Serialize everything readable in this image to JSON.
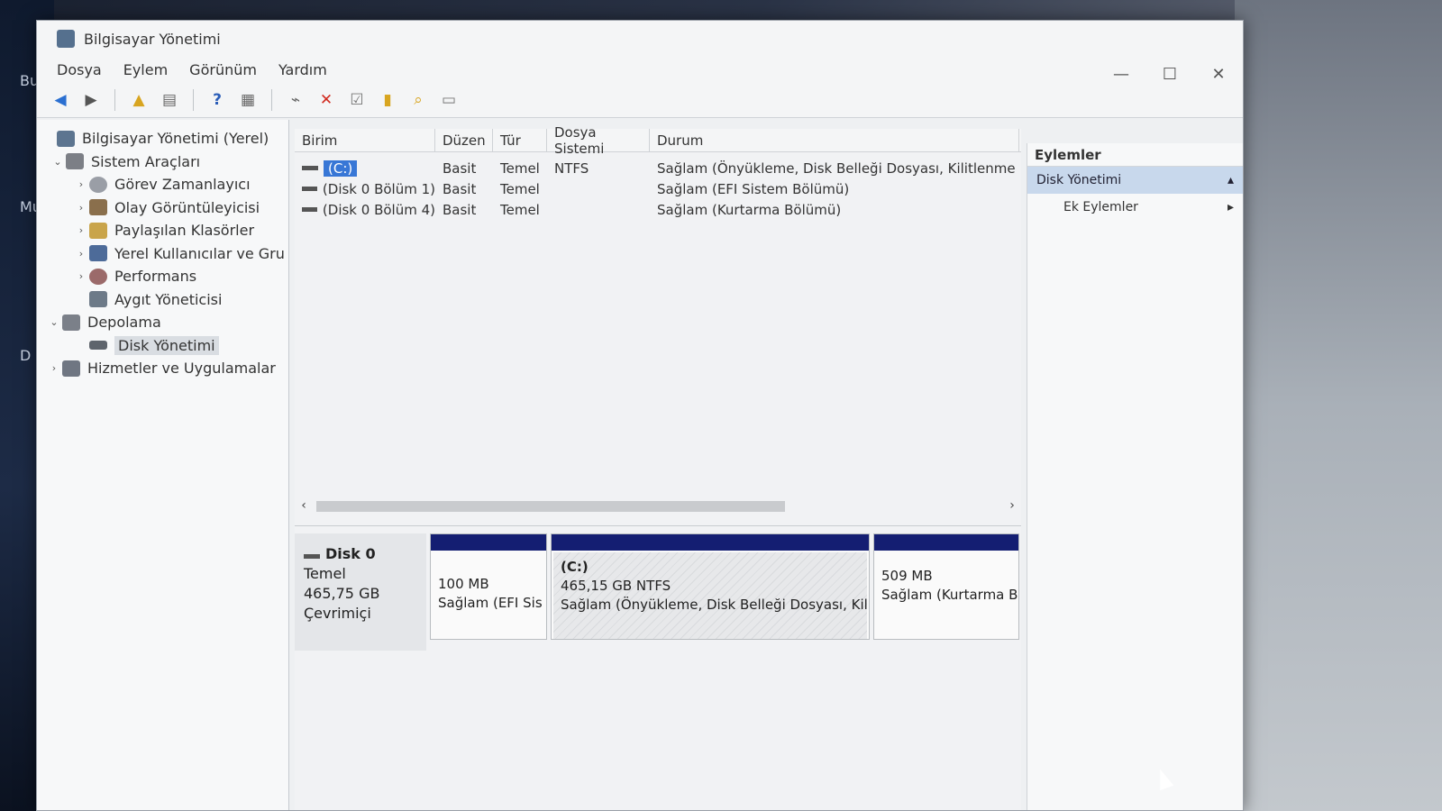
{
  "desktop": {
    "labels": [
      "Bu",
      "Mu",
      "D"
    ]
  },
  "window": {
    "title": "Bilgisayar Yönetimi"
  },
  "window_controls": {
    "minimize": "—",
    "maximize": "☐",
    "close": "✕"
  },
  "menu": [
    "Dosya",
    "Eylem",
    "Görünüm",
    "Yardım"
  ],
  "tree": {
    "root": "Bilgisayar Yönetimi (Yerel)",
    "sistem": "Sistem Araçları",
    "gorev": "Görev Zamanlayıcı",
    "olay": "Olay Görüntüleyicisi",
    "paylasilan": "Paylaşılan Klasörler",
    "yerel": "Yerel Kullanıcılar ve Gru",
    "performans": "Performans",
    "aygit": "Aygıt Yöneticisi",
    "depolama": "Depolama",
    "disk": "Disk Yönetimi",
    "hizmetler": "Hizmetler ve Uygulamalar"
  },
  "volumes": {
    "columns": [
      "Birim",
      "Düzen",
      "Tür",
      "Dosya Sistemi",
      "Durum"
    ],
    "rows": [
      {
        "name": "(C:)",
        "layout": "Basit",
        "type": "Temel",
        "fs": "NTFS",
        "status": "Sağlam (Önyükleme, Disk Belleği Dosyası, Kilitlenme Bilgis"
      },
      {
        "name": "(Disk 0 Bölüm 1)",
        "layout": "Basit",
        "type": "Temel",
        "fs": "",
        "status": "Sağlam (EFI Sistem Bölümü)"
      },
      {
        "name": "(Disk 0 Bölüm 4)",
        "layout": "Basit",
        "type": "Temel",
        "fs": "",
        "status": "Sağlam (Kurtarma Bölümü)"
      }
    ]
  },
  "disk": {
    "name": "Disk 0",
    "type": "Temel",
    "size": "465,75 GB",
    "state": "Çevrimiçi",
    "partitions": [
      {
        "title": "",
        "size": "100 MB",
        "status": "Sağlam (EFI Sis"
      },
      {
        "title": "(C:)",
        "size": "465,15 GB NTFS",
        "status": "Sağlam (Önyükleme, Disk Belleği Dosyası, Kilitle"
      },
      {
        "title": "",
        "size": "509 MB",
        "status": "Sağlam (Kurtarma Bö"
      }
    ]
  },
  "actions": {
    "header": "Eylemler",
    "selected": "Disk Yönetimi",
    "more": "Ek Eylemler"
  },
  "colors": {
    "partition_bar": "#141e72",
    "selection": "#3877d6"
  }
}
